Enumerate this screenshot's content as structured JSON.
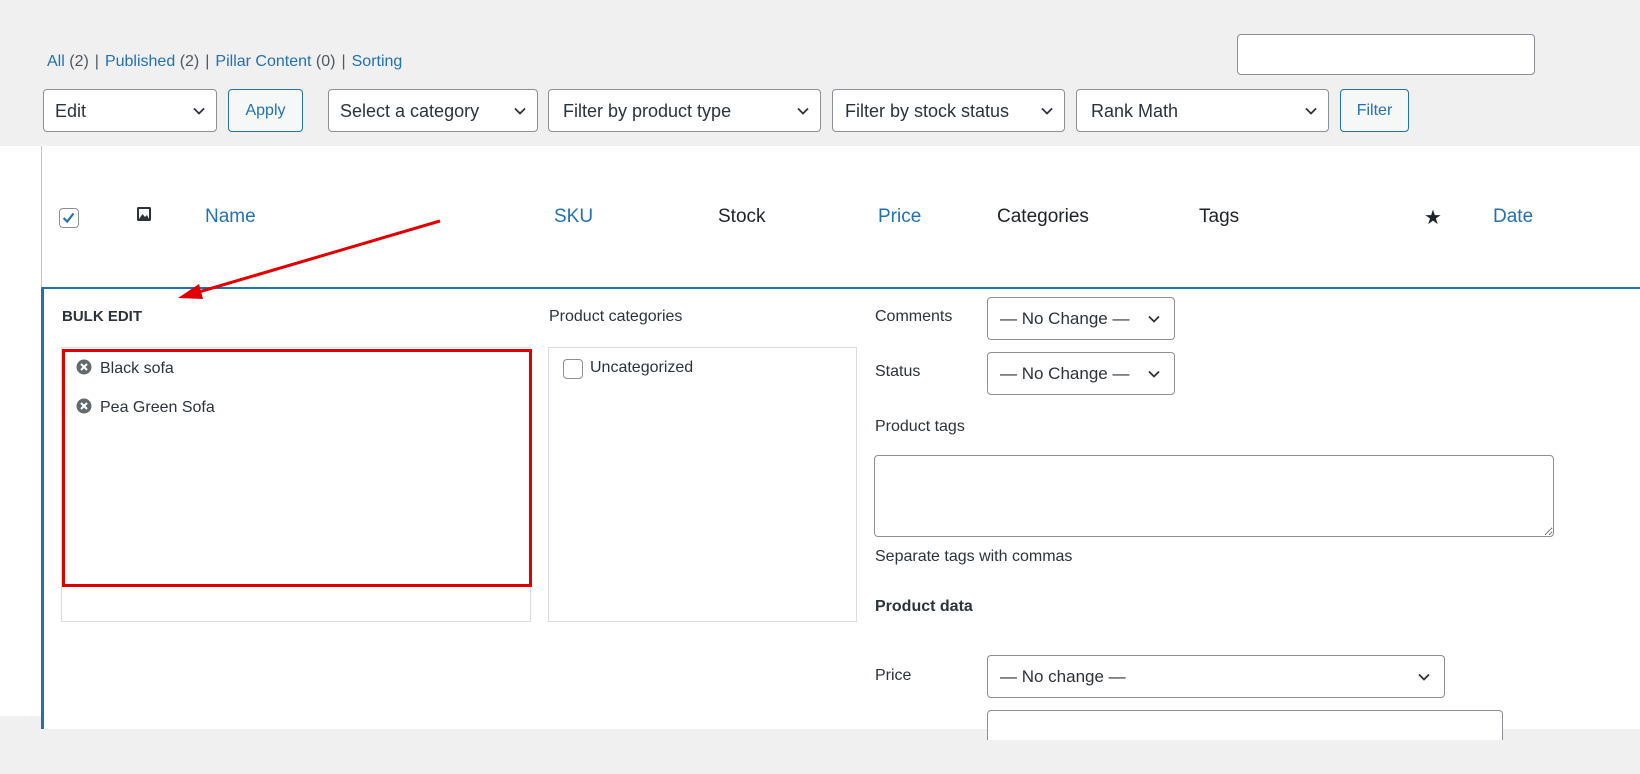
{
  "views": {
    "all": {
      "label": "All",
      "count": "(2)"
    },
    "published": {
      "label": "Published",
      "count": "(2)"
    },
    "pillar": {
      "label": "Pillar Content",
      "count": "(0)"
    },
    "sorting": {
      "label": "Sorting"
    }
  },
  "search": {
    "value": "",
    "placeholder": ""
  },
  "toolbar": {
    "bulk_action": "Edit",
    "apply_label": "Apply",
    "category_filter": "Select a category",
    "product_type_filter": "Filter by product type",
    "stock_status_filter": "Filter by stock status",
    "seo_filter": "Rank Math",
    "filter_label": "Filter"
  },
  "columns": {
    "name": "Name",
    "sku": "SKU",
    "stock": "Stock",
    "price": "Price",
    "categories": "Categories",
    "tags": "Tags",
    "date": "Date",
    "image_icon": "image-icon",
    "featured_icon": "star-icon"
  },
  "bulk_edit": {
    "title": "BULK EDIT",
    "items": [
      {
        "name": "Black sofa"
      },
      {
        "name": "Pea Green Sofa"
      }
    ],
    "categories_label": "Product categories",
    "categories": [
      {
        "label": "Uncategorized",
        "checked": false
      }
    ],
    "comments_label": "Comments",
    "comments_value": "— No Change —",
    "status_label": "Status",
    "status_value": "— No Change —",
    "tags_label": "Product tags",
    "tags_value": "",
    "tags_hint": "Separate tags with commas",
    "product_data_label": "Product data",
    "price_label": "Price",
    "price_value": "— No change —"
  },
  "colors": {
    "link": "#2271b1",
    "highlight": "#e00000",
    "accent_border": "#2271b1",
    "background": "#f0f0f1"
  }
}
